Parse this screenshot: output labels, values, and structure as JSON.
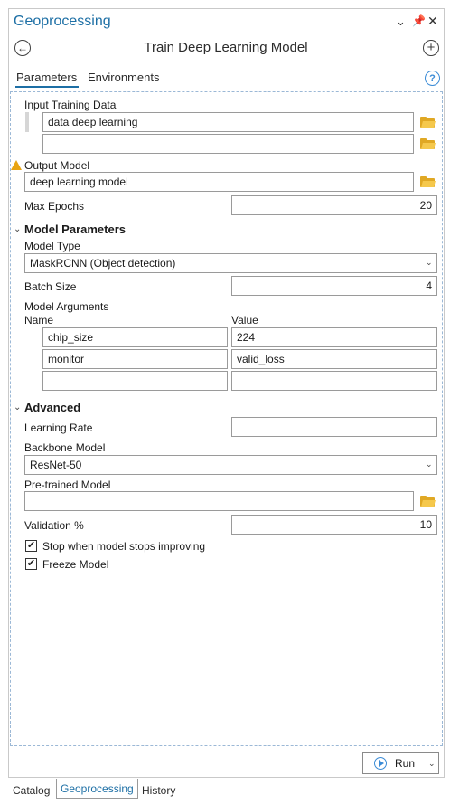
{
  "pane": {
    "title": "Geoprocessing",
    "tool_title": "Train Deep Learning Model",
    "tabs": [
      {
        "label": "Parameters",
        "active": true
      },
      {
        "label": "Environments",
        "active": false
      }
    ],
    "icons": [
      "chevron-down-icon",
      "pin-icon",
      "close-icon",
      "back-icon",
      "add-icon",
      "help-icon"
    ],
    "accent_color": "#1d6fa5"
  },
  "params": {
    "input_training_data_label": "Input Training Data",
    "input_training_data_values": [
      "data deep learning",
      ""
    ],
    "output_model_label": "Output Model",
    "output_model_value": "deep learning model",
    "max_epochs_label": "Max Epochs",
    "max_epochs_value": "20"
  },
  "model_parameters": {
    "heading": "Model Parameters",
    "model_type_label": "Model Type",
    "model_type_value": "MaskRCNN (Object detection)",
    "batch_size_label": "Batch Size",
    "batch_size_value": "4",
    "model_arguments_label": "Model Arguments",
    "name_header": "Name",
    "value_header": "Value",
    "arguments": [
      {
        "name": "chip_size",
        "value": "224"
      },
      {
        "name": "monitor",
        "value": "valid_loss"
      },
      {
        "name": "",
        "value": ""
      }
    ]
  },
  "advanced": {
    "heading": "Advanced",
    "learning_rate_label": "Learning Rate",
    "learning_rate_value": "",
    "backbone_label": "Backbone Model",
    "backbone_value": "ResNet-50",
    "pretrained_label": "Pre-trained Model",
    "pretrained_value": "",
    "validation_label": "Validation %",
    "validation_value": "10",
    "stop_label": "Stop when model stops improving",
    "stop_checked": true,
    "freeze_label": "Freeze Model",
    "freeze_checked": true,
    "check_mark": "✔"
  },
  "footer": {
    "run_label": "Run"
  },
  "bottom_tabs": [
    {
      "label": "Catalog",
      "active": false
    },
    {
      "label": "Geoprocessing",
      "active": true
    },
    {
      "label": "History",
      "active": false
    }
  ]
}
